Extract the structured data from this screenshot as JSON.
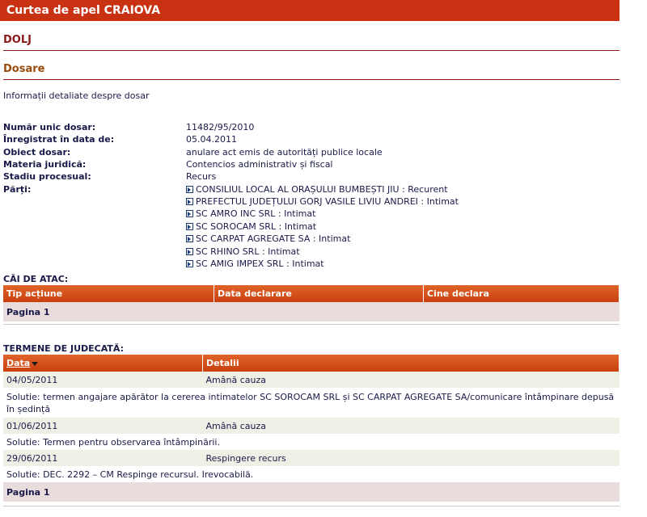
{
  "header": {
    "court": "Curtea de apel CRAIOVA",
    "county": "DOLJ"
  },
  "section": {
    "title": "Dosare",
    "intro": "Informații detaliate despre dosar"
  },
  "case": {
    "labels": {
      "number": "Număr unic dosar:",
      "registered": "Înregistrat în data de:",
      "object": "Obiect dosar:",
      "matter": "Materia juridică:",
      "stage": "Stadiu procesual:",
      "parties": "Părți:"
    },
    "number": "11482/95/2010",
    "registered": "05.04.2011",
    "object": "anulare act emis de autorități publice locale",
    "matter": "Contencios administrativ și fiscal",
    "stage": "Recurs",
    "parties": [
      "CONSILIUL LOCAL AL ORAȘULUI BUMBEȘTI JIU : Recurent",
      "PREFECTUL JUDEȚULUI GORJ VASILE LIVIU ANDREI : Intimat",
      "SC AMRO INC SRL : Intimat",
      "SC SOROCAM SRL : Intimat",
      "SC CARPAT AGREGATE SA : Intimat",
      "SC RHINO SRL : Intimat",
      "SC AMIG IMPEX SRL : Intimat"
    ]
  },
  "appeals": {
    "title": "CĂI DE ATAC:",
    "columns": [
      "Tip acțiune",
      "Data declarare",
      "Cine declara"
    ],
    "pager": "Pagina 1"
  },
  "hearings": {
    "title": "TERMENE DE JUDECATĂ:",
    "columns": [
      "Data",
      "Detalii"
    ],
    "rows": [
      {
        "date": "04/05/2011",
        "detail": "Amână cauza",
        "solution": "Solutie: termen angajare apărător la cererea intimatelor SC SOROCAM SRL și SC CARPAT AGREGATE SA/comunicare întâmpinare depusă în ședință"
      },
      {
        "date": "01/06/2011",
        "detail": "Amână cauza",
        "solution": "Solutie: Termen pentru observarea întâmpinării."
      },
      {
        "date": "29/06/2011",
        "detail": "Respingere recurs",
        "solution": "Solutie: DEC. 2292 – CM Respinge recursul. Irevocabilă."
      }
    ],
    "pager": "Pagina 1"
  }
}
